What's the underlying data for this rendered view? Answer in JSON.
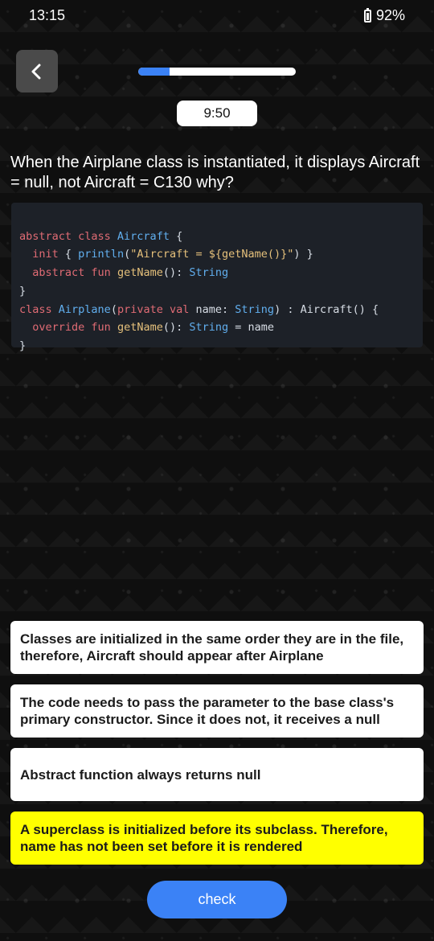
{
  "status_bar": {
    "time": "13:15",
    "battery_percent": "92%"
  },
  "progress": {
    "fraction": 0.2
  },
  "timer": "9:50",
  "question": "When the Airplane class is instantiated, it displays Aircraft = null, not Aircraft = C130 why?",
  "code": {
    "lines": [
      "abstract class Aircraft {",
      "  init { println(\"Aircraft = ${getName()}\") }",
      "  abstract fun getName(): String",
      "}",
      "class Airplane(private val name: String) : Aircraft() {",
      "  override fun getName(): String = name",
      "}"
    ]
  },
  "answers": [
    {
      "text": "Classes are initialized in the same order they are in the file, therefore, Aircraft should appear after Airplane",
      "selected": false
    },
    {
      "text": "The code needs to pass the parameter to the base class's primary constructor. Since it does not, it receives a null",
      "selected": false
    },
    {
      "text": "Abstract function always returns null",
      "selected": false
    },
    {
      "text": "A superclass is initialized before its subclass. Therefore, name has not been set before it is rendered",
      "selected": true
    }
  ],
  "check_label": "check",
  "colors": {
    "accent": "#3b82f6",
    "selected": "#ffff00",
    "code_bg": "#1d2128"
  }
}
